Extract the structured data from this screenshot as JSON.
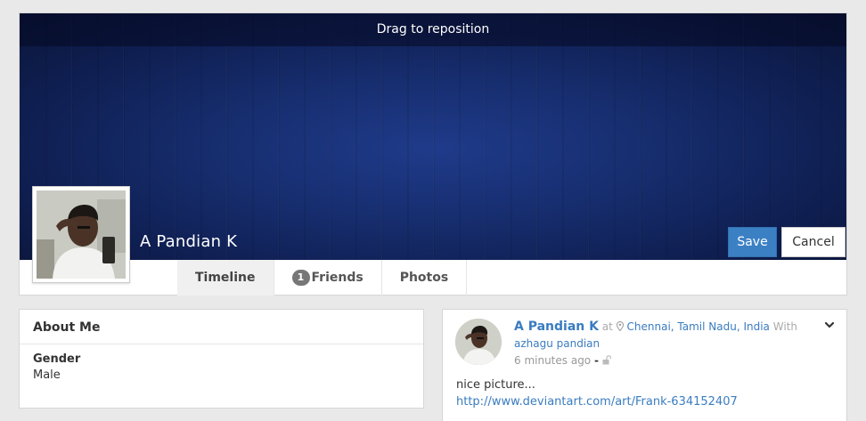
{
  "cover": {
    "drag_hint": "Drag to reposition",
    "profile_name": "A Pandian K",
    "save_label": "Save",
    "cancel_label": "Cancel"
  },
  "tabs": [
    {
      "label": "Timeline",
      "active": true
    },
    {
      "label": "Friends",
      "badge": "1"
    },
    {
      "label": "Photos"
    }
  ],
  "about": {
    "title": "About Me",
    "gender_label": "Gender",
    "gender_value": "Male"
  },
  "post": {
    "author": "A Pandian K",
    "at_text": "at",
    "location": "Chennai, Tamil Nadu, India",
    "with_text": "With",
    "tagged": "azhagu pandian",
    "time": "6 minutes ago",
    "separator": "-",
    "text": "nice picture...",
    "url": "http://www.deviantart.com/art/Frank-634152407",
    "icons": [
      "map-marker-icon",
      "unlock-icon",
      "chevron-down-icon"
    ]
  },
  "colors": {
    "accent": "#3c80c4",
    "link": "#3a7cc0",
    "cover_dark": "#0f1f52"
  }
}
